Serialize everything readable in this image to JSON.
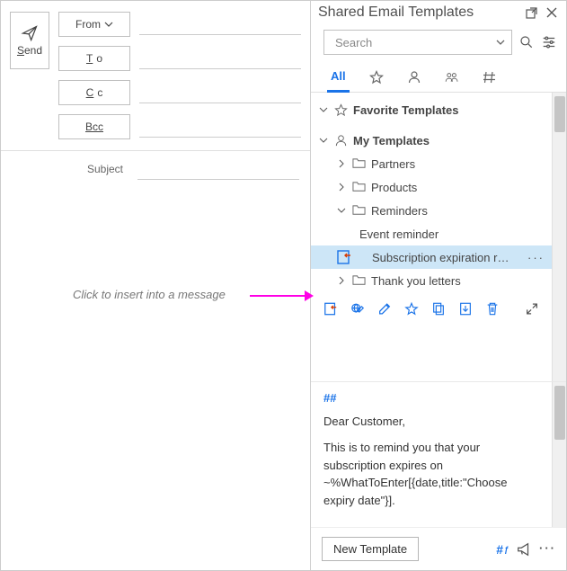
{
  "compose": {
    "send_label": "end",
    "from_label": "From",
    "to_label": "o",
    "cc_label": "c",
    "bcc_label": "Bcc",
    "subject_label": "Subject"
  },
  "annotation": {
    "text": "Click to insert into a message"
  },
  "panel": {
    "title": "Shared Email Templates"
  },
  "search": {
    "placeholder": "Search"
  },
  "tabs": {
    "all": "All"
  },
  "tree": {
    "favorites_label": "Favorite Templates",
    "my_templates_label": "My Templates",
    "partners_label": "Partners",
    "products_label": "Products",
    "reminders_label": "Reminders",
    "event_reminder_label": "Event reminder",
    "subscription_reminder_label": "Subscription expiration remi...",
    "thank_you_label": "Thank you letters",
    "selected_more": "···"
  },
  "preview": {
    "hash": "##",
    "greeting": "Dear Customer,",
    "body": "This is to remind you that your subscription expires on ~%WhatToEnter[{date,title:\"Choose expiry date\"}]."
  },
  "footer": {
    "new_template_label": "New Template"
  }
}
